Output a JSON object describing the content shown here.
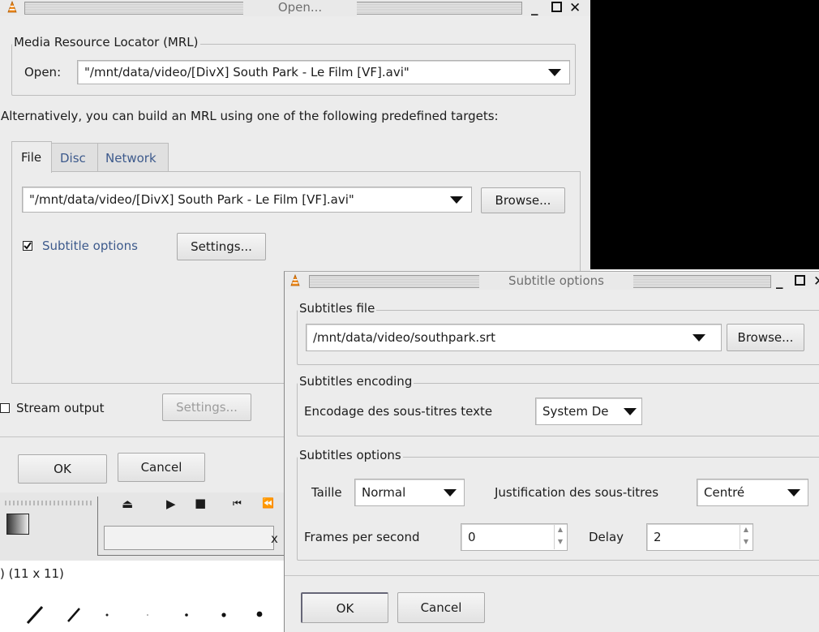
{
  "open_window": {
    "title": "Open...",
    "mrl_group": "Media Resource Locator (MRL)",
    "open_label": "Open:",
    "open_value": "\"/mnt/data/video/[DivX] South Park - Le Film [VF].avi\"",
    "alt_text": "Alternatively, you can build an MRL using one of the following predefined targets:",
    "tabs": [
      "File",
      "Disc",
      "Network"
    ],
    "file_value": "\"/mnt/data/video/[DivX] South Park - Le Film [VF].avi\"",
    "browse": "Browse...",
    "subtitle_checkbox": "Subtitle options",
    "subtitle_settings": "Settings...",
    "stream_output": "Stream output",
    "stream_settings": "Settings...",
    "ok": "OK",
    "cancel": "Cancel"
  },
  "subtitle_window": {
    "title": "Subtitle options",
    "file_group": "Subtitles file",
    "file_value": "/mnt/data/video/southpark.srt",
    "browse": "Browse...",
    "encoding_group": "Subtitles encoding",
    "encoding_label": "Encodage des sous-titres texte",
    "encoding_value": "System De",
    "options_group": "Subtitles options",
    "size_label": "Taille",
    "size_value": "Normal",
    "justification_label": "Justification des sous-titres",
    "justification_value": "Centré",
    "fps_label": "Frames per second",
    "fps_value": "0",
    "delay_label": "Delay",
    "delay_value": "2",
    "ok": "OK",
    "cancel": "Cancel"
  },
  "background": {
    "size_text": ") (11 x 11)",
    "player_entry_char": "x"
  },
  "colors": {
    "window_bg": "#ececec",
    "link_blue": "#3d5a8c",
    "desktop_black": "#000000"
  }
}
